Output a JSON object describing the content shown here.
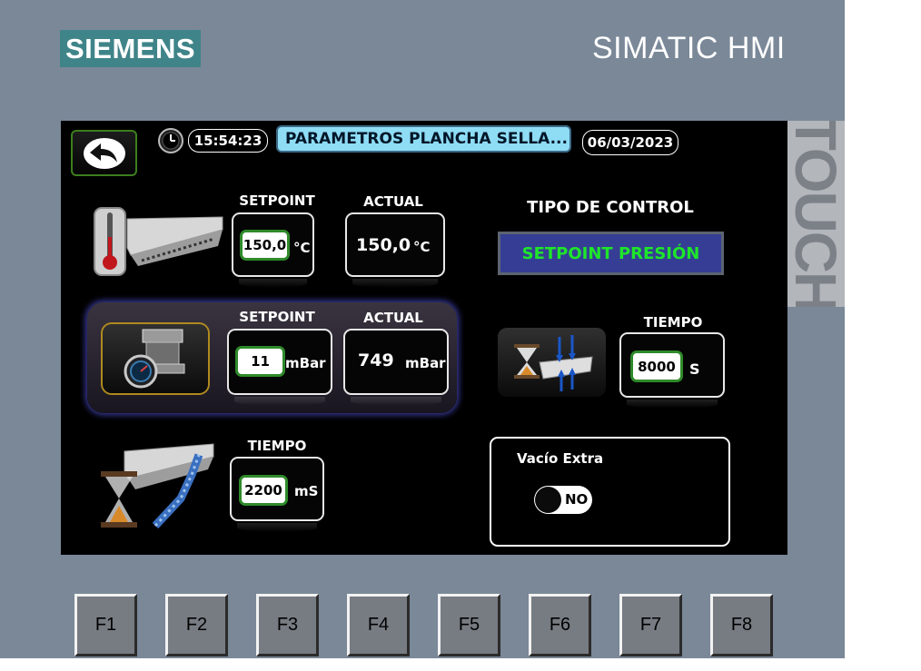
{
  "bezel": {
    "brand": "SIEMENS",
    "model": "SIMATIC HMI",
    "touch": "TOUCH",
    "fkeys": [
      "F1",
      "F2",
      "F3",
      "F4",
      "F5",
      "F6",
      "F7",
      "F8"
    ]
  },
  "header": {
    "time": "15:54:23",
    "title": "PARAMETROS PLANCHA SELLA...",
    "date": "06/03/2023"
  },
  "temperature": {
    "setpoint_label": "SETPOINT",
    "actual_label": "ACTUAL",
    "setpoint_value": "150,0",
    "setpoint_unit": "°C",
    "actual_value": "150,0",
    "actual_unit": "°C"
  },
  "pressure": {
    "setpoint_label": "SETPOINT",
    "actual_label": "ACTUAL",
    "setpoint_value": "11",
    "setpoint_unit": "mBar",
    "actual_value": "749",
    "actual_unit": "mBar"
  },
  "sealing_time": {
    "label": "TIEMPO",
    "value": "2200",
    "unit": "mS"
  },
  "control_type": {
    "label": "TIPO DE CONTROL",
    "button": "SETPOINT PRESIÓN"
  },
  "pressure_time": {
    "label": "TIEMPO",
    "value": "8000",
    "unit": "S"
  },
  "extra_vacuum": {
    "label": "Vacío Extra",
    "state": "NO"
  },
  "colors": {
    "bezel": "#7a8898",
    "brand": "#3f8488",
    "title_bar": "#8fdcf5",
    "control_button": "#353e94",
    "control_text": "#1ee62a",
    "field_border": "#2f8a2a"
  }
}
